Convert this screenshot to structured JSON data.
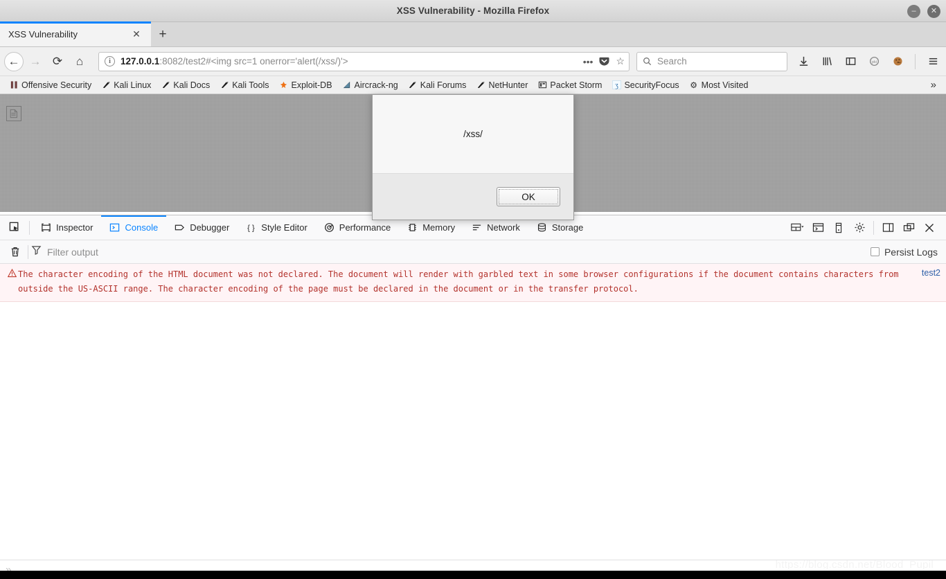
{
  "window": {
    "title": "XSS Vulnerability - Mozilla Firefox",
    "minimize_label": "–",
    "close_label": "✕"
  },
  "tabs": {
    "items": [
      {
        "title": "XSS Vulnerability",
        "close_label": "✕"
      }
    ],
    "new_tab_label": "+"
  },
  "navbar": {
    "back_label": "←",
    "forward_label": "→",
    "reload_label": "⟳",
    "home_label": "⌂",
    "identity_icon_label": "i",
    "url_host": "127.0.0.1",
    "url_rest": ":8082/test2#<img src=1 onerror='alert(/xss/)'>",
    "url_full": "127.0.0.1:8082/test2#<img src=1 onerror='alert(/xss/)'>",
    "page_actions_label": "•••",
    "pocket_label": "pocket-icon",
    "bookmark_star_label": "☆",
    "search_placeholder": "Search",
    "right_icons": [
      {
        "name": "downloads-icon",
        "glyph": "⬇"
      },
      {
        "name": "library-icon",
        "glyph": "Ⅲ∖"
      },
      {
        "name": "sidebars-icon",
        "glyph": "◫"
      },
      {
        "name": "account-icon",
        "glyph": "○"
      },
      {
        "name": "cookie-icon",
        "glyph": "●"
      },
      {
        "name": "menu-icon",
        "glyph": "☰"
      }
    ]
  },
  "bookmarks": {
    "items": [
      {
        "label": "Offensive Security",
        "icon": "offsec-icon",
        "glyph": "▐▌"
      },
      {
        "label": "Kali Linux",
        "icon": "dragon-icon",
        "glyph": "✒"
      },
      {
        "label": "Kali Docs",
        "icon": "dragon-icon",
        "glyph": "✒"
      },
      {
        "label": "Kali Tools",
        "icon": "dragon-icon",
        "glyph": "✒"
      },
      {
        "label": "Exploit-DB",
        "icon": "exploitdb-icon",
        "glyph": "✽"
      },
      {
        "label": "Aircrack-ng",
        "icon": "aircrack-icon",
        "glyph": "◢"
      },
      {
        "label": "Kali Forums",
        "icon": "dragon-icon",
        "glyph": "✒"
      },
      {
        "label": "NetHunter",
        "icon": "dragon-icon",
        "glyph": "✒"
      },
      {
        "label": "Packet Storm",
        "icon": "packetstorm-icon",
        "glyph": "▤"
      },
      {
        "label": "SecurityFocus",
        "icon": "securityfocus-icon",
        "glyph": "ʒ"
      },
      {
        "label": "Most Visited",
        "icon": "gear-icon",
        "glyph": "⚙"
      }
    ],
    "overflow_label": "»"
  },
  "page": {
    "broken_image_alt": "broken-image"
  },
  "dialog": {
    "message": "/xss/",
    "ok_label": "OK"
  },
  "devtools": {
    "picker_label": "element-picker",
    "tabs": [
      {
        "label": "Inspector",
        "icon": "inspector-icon",
        "active": false
      },
      {
        "label": "Console",
        "icon": "console-icon",
        "active": true
      },
      {
        "label": "Debugger",
        "icon": "debugger-icon",
        "active": false
      },
      {
        "label": "Style Editor",
        "icon": "style-editor-icon",
        "active": false
      },
      {
        "label": "Performance",
        "icon": "performance-icon",
        "active": false
      },
      {
        "label": "Memory",
        "icon": "memory-icon",
        "active": false
      },
      {
        "label": "Network",
        "icon": "network-icon",
        "active": false
      },
      {
        "label": "Storage",
        "icon": "storage-icon",
        "active": false
      }
    ],
    "toolbar_right": [
      {
        "name": "responsive-layout-icon",
        "glyph": "▤"
      },
      {
        "name": "split-console-icon",
        "glyph": "▥"
      },
      {
        "name": "responsive-design-mode-icon",
        "glyph": "▯"
      },
      {
        "name": "settings-gear-icon",
        "glyph": "⚙"
      },
      {
        "name": "dock-side-icon",
        "glyph": "◫"
      },
      {
        "name": "separate-window-icon",
        "glyph": "⧉"
      },
      {
        "name": "close-devtools-icon",
        "glyph": "✕"
      }
    ],
    "filterbar": {
      "clear_label": "Ὕ1",
      "filter_icon_label": "filter-icon",
      "filter_placeholder": "Filter output",
      "persist_logs_label": "Persist Logs",
      "persist_logs_checked": false
    },
    "console_messages": [
      {
        "level": "warning",
        "icon": "warning-triangle-icon",
        "text": "The character encoding of the HTML document was not declared. The document will render with garbled text in some browser configurations if the document contains characters from outside the US-ASCII range. The character encoding of the page must be declared in the document or in the transfer protocol.",
        "source": "test2"
      }
    ],
    "prompt_label": "»"
  },
  "watermark": {
    "text": "https://blog.csdn.net/Blood_Pupil"
  },
  "colors": {
    "accent": "#0a84ff",
    "error_text": "#b3322c",
    "error_bg": "#fff4f6",
    "chrome_bg": "#f0f0f0"
  }
}
